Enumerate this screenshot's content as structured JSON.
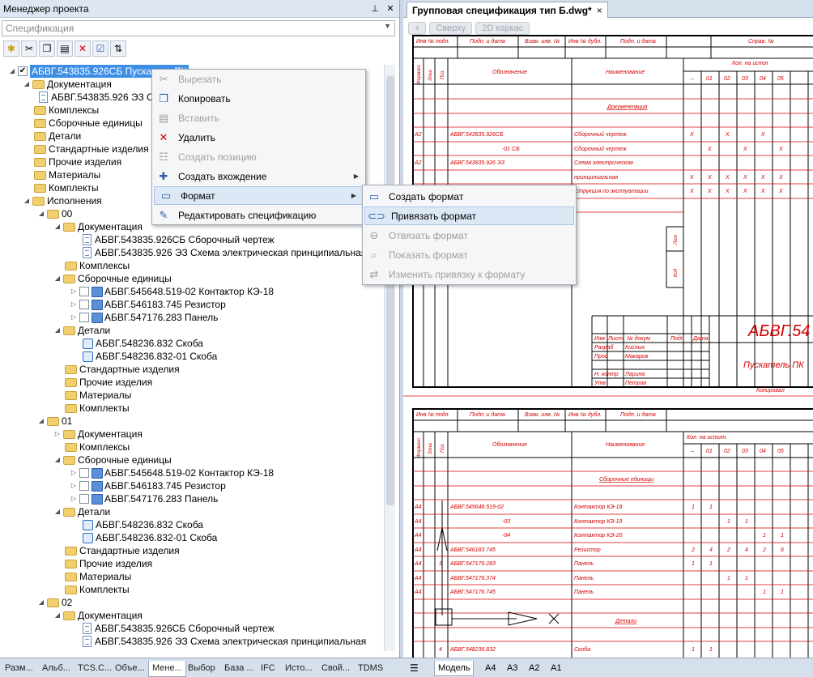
{
  "left_panel": {
    "title": "Менеджер проекта",
    "pin_icon": "pin-icon",
    "close_icon": "close-icon",
    "combo_value": "Спецификация"
  },
  "toolbar": {
    "icons": [
      "new-object-icon",
      "cut-icon",
      "copy-icon",
      "paste-icon",
      "delete-icon",
      "properties-icon",
      "sort-icon"
    ]
  },
  "tree": {
    "root": "АБВГ.543835.926СБ Пускатель ПК",
    "documentation": "Документация",
    "doc_item": "АБВГ.543835.926 ЭЗ Схема электрическая принципиальная",
    "complexes": "Комплексы",
    "assemblies": "Сборочные единицы",
    "details": "Детали",
    "standard": "Стандартные изделия",
    "other": "Прочие изделия",
    "materials": "Материалы",
    "kits": "Комплекты",
    "variants": "Исполнения",
    "v00": "00",
    "v01": "01",
    "v02": "02",
    "d_sb": "АБВГ.543835.926СБ Сборочный чертеж",
    "d_ez": "АБВГ.543835.926 ЭЗ Схема электрическая принципиальная",
    "a1": "АБВГ.545648.519-02 Контактор КЭ-18",
    "a2": "АБВГ.546183.745 Резистор",
    "a3": "АБВГ.547176.283 Панель",
    "p1": "АБВГ.548236.832 Скоба",
    "p2": "АБВГ.548236.832-01 Скоба"
  },
  "context_menu": {
    "items": [
      "Вырезать",
      "Копировать",
      "Вставить",
      "Удалить",
      "Создать позицию",
      "Создать вхождение",
      "Формат",
      "Редактировать спецификацию"
    ]
  },
  "submenu": {
    "items": [
      "Создать формат",
      "Привязать формат",
      "Отвязать формат",
      "Показать формат",
      "Изменить привязку к формату"
    ]
  },
  "doc_tab": {
    "title": "Групповая спецификация тип Б.dwg*",
    "close": "×"
  },
  "view_toolbar": {
    "plus": "+",
    "top": "Сверху",
    "mode": "2D каркас"
  },
  "drawing": {
    "h1": "Инв № подл.",
    "h2": "Подп. и дата",
    "h3": "Взам. инв. №",
    "h4": "Инв № дубл.",
    "h5": "Подп. и дата",
    "h6": "Справ. №",
    "col_format": "Формат",
    "col_zone": "Зона",
    "col_pos": "Поз.",
    "col_oboz": "Обозначение",
    "col_naim": "Наименование",
    "qty1": "Кол. на испол",
    "qty2": "Кол. на исполн.",
    "dash": "–",
    "v01": "01",
    "v02": "02",
    "v03": "03",
    "v04": "04",
    "v05": "05",
    "sec_docs": "Документация",
    "r1_f": "А2",
    "r1_o": "АБВГ.543835.926СБ",
    "r1_n": "Сборочный чертеж",
    "r2_o": "-01 СБ",
    "r2_n": "Сборочный чертеж",
    "r3_f": "А2",
    "r3_o": "АБВГ.543835.926 ЭЗ",
    "r3_n": "Схема электрическая",
    "r4_n": "принципиальная",
    "r5_n": "нструкция по эксплуатации",
    "x": "X",
    "side1": "Лит",
    "side2": "Код",
    "stamp_code": "АБВГ.54",
    "stamp_name": "Пускатель ПК",
    "stamp_izm": "Изм",
    "stamp_list": "Лист",
    "stamp_ndoc": "№ докум",
    "stamp_podp": "Подп",
    "stamp_data": "Дата",
    "razrab": "Разраб",
    "razrab_n": "Кислых",
    "prov": "Пров",
    "prov_n": "Макаров",
    "nkontr": "Н. контр",
    "nkontr_n": "Ларина",
    "utv": "Утв",
    "utv_n": "Петров",
    "copied": "Копировал",
    "sec_asm": "Сборочные единицы",
    "b1_f": "А4",
    "b1_o": "АБВГ.545648.519-02",
    "b1_n": "Контактор КЭ-18",
    "b2_f": "А4",
    "b2_o": "-03",
    "b2_n": "Контактор КЭ-19",
    "b3_f": "А4",
    "b3_o": "-04",
    "b3_n": "Контактор КЭ-20",
    "b4_f": "А4",
    "b4_o": "АБВГ.546183.745",
    "b4_n": "Резистор",
    "b5_f": "А4",
    "b5_p": "3",
    "b5_o": "АБВГ.547176.283",
    "b5_n": "Панель",
    "b6_f": "А4",
    "b6_o": "АБВГ.547176.374",
    "b6_n": "Панель",
    "b7_f": "А4",
    "b7_o": "АБВГ.547176.745",
    "b7_n": "Панель",
    "sec_det": "Детали",
    "b8_p": "4",
    "b8_o": "АБВГ.548236.832",
    "b8_n": "Скоба",
    "n1": "1",
    "n2": "2",
    "n4": "4",
    "n6": "6"
  },
  "bottom_tabs": [
    "Разм...",
    "Альб...",
    "TCS.C...",
    "Объе...",
    "Мене...",
    "Выбор",
    "База ...",
    "IFC",
    "Исто...",
    "Свой...",
    "TDMS"
  ],
  "model_tabs": [
    "Модель",
    "А4",
    "А3",
    "А2",
    "А1"
  ],
  "colors": {
    "drawing_red": "#d40000",
    "selection": "#3d8ee6"
  }
}
